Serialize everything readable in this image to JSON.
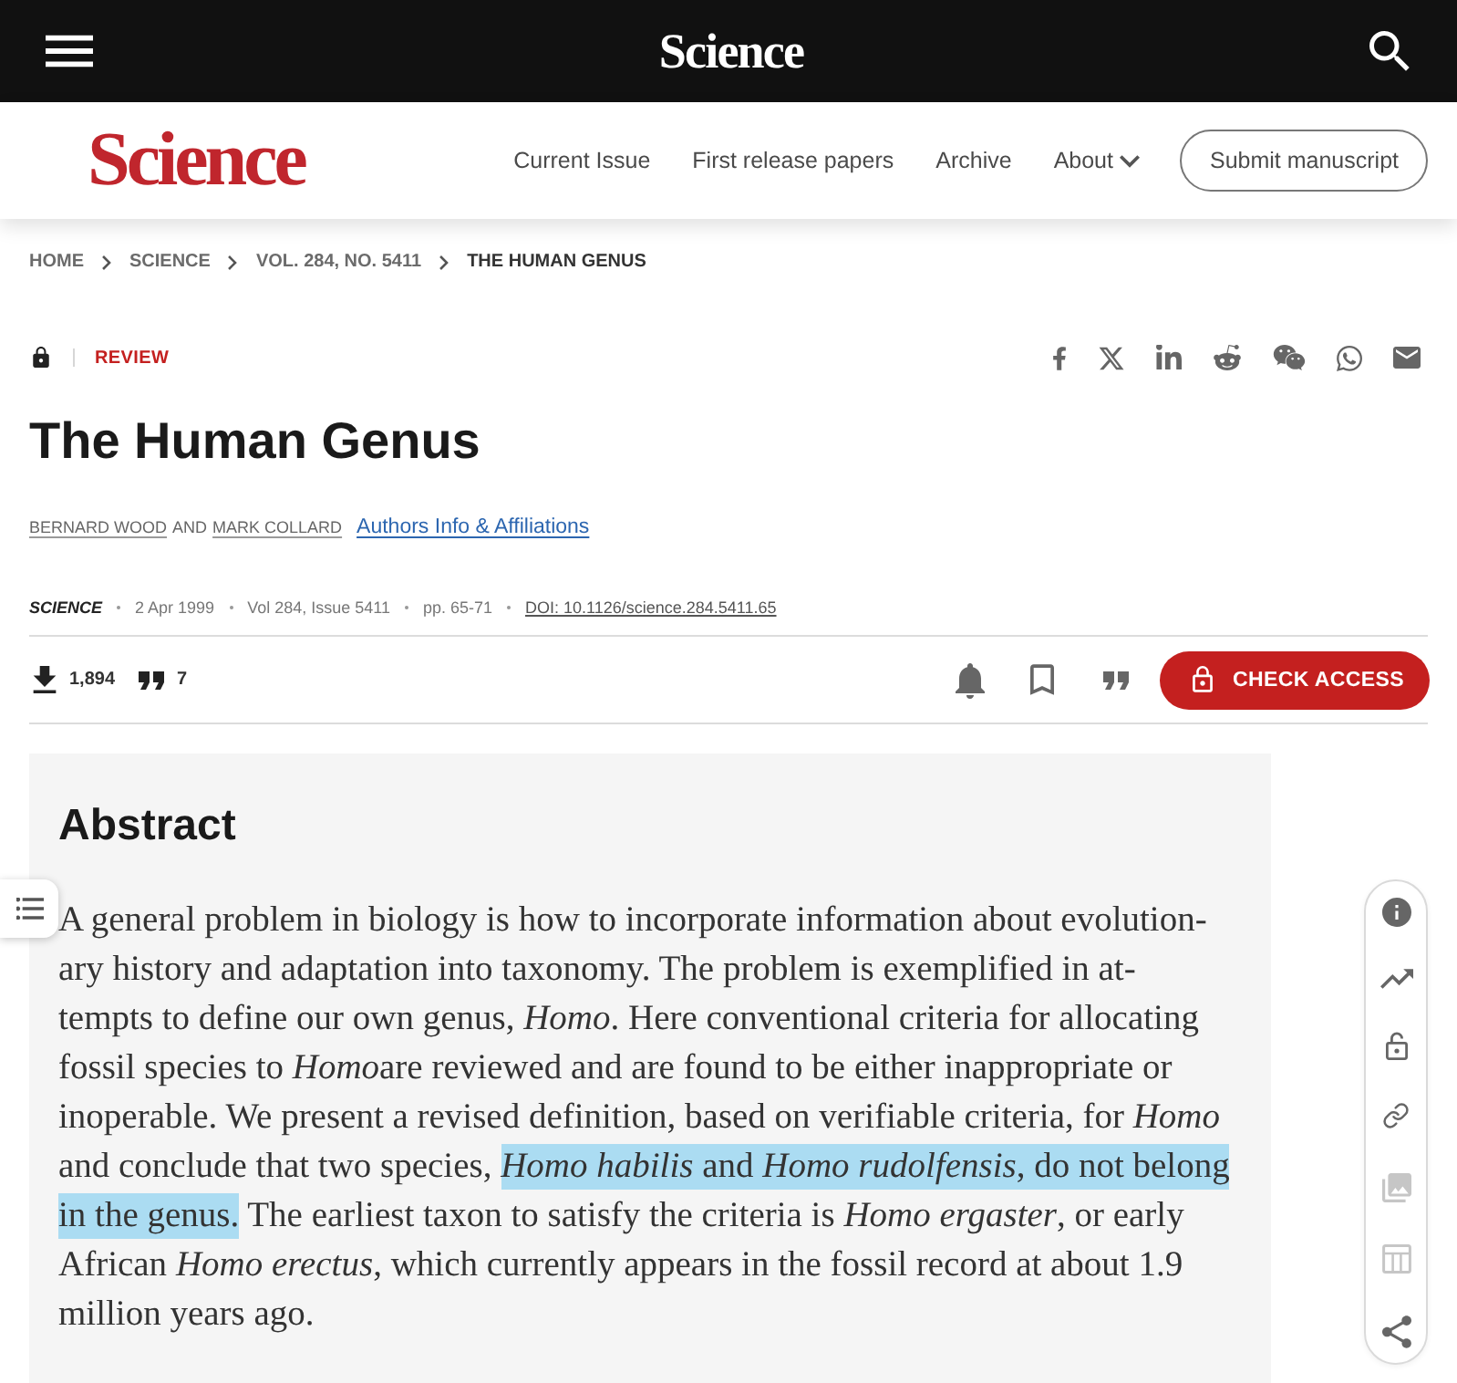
{
  "top_bar": {
    "logo": "Science"
  },
  "header": {
    "logo": "Science",
    "nav": [
      {
        "label": "Current Issue",
        "kind": "link"
      },
      {
        "label": "First release papers",
        "kind": "link"
      },
      {
        "label": "Archive",
        "kind": "link"
      },
      {
        "label": "About",
        "kind": "menu"
      }
    ],
    "submit_button": "Submit manuscript"
  },
  "breadcrumb": [
    {
      "label": "HOME",
      "current": false
    },
    {
      "label": "SCIENCE",
      "current": false
    },
    {
      "label": "VOL. 284, NO. 5411",
      "current": false
    },
    {
      "label": "THE HUMAN GENUS",
      "current": true
    }
  ],
  "article": {
    "type_label": "REVIEW",
    "title": "The Human Genus",
    "authors": [
      "BERNARD WOOD",
      "MARK COLLARD"
    ],
    "authors_conjunction": "AND",
    "authors_info_link": "Authors Info & Affiliations",
    "meta": {
      "journal": "SCIENCE",
      "date": "2 Apr 1999",
      "issue": "Vol 284, Issue 5411",
      "pages": "pp. 65-71",
      "doi": "DOI: 10.1126/science.284.5411.65"
    },
    "downloads": "1,894",
    "citations": "7",
    "check_access_button": "CHECK ACCESS"
  },
  "abstract": {
    "heading": "Abstract",
    "runs": [
      {
        "text": "A general problem in biology is how to incorporate information about evolution-\nary history and adaptation into taxonomy. The problem is exemplified in at-\ntempts to define our own genus, *Homo*. Here conventional criteria for allocating\nfossil species to ",
        "highlighted": false
      },
      {
        "text": "*Homo*",
        "highlighted": false
      },
      {
        "text": "are reviewed and are found to be either inappropriate or\ninoperable. We present a revised definition, based on verifiable criteria, for *Homo*\nand conclude that two species, ",
        "highlighted": false
      },
      {
        "text": "*Homo habilis* and *Homo rudolfensis*, do not belong\nin the genus.",
        "highlighted": true
      },
      {
        "text": " The earliest taxon to satisfy the criteria is *Homo ergaster*, or early\nAfrican *Homo erectus*, which currently appears in the fossil record at about 1.9\nmillion years ago.",
        "highlighted": false
      }
    ]
  },
  "side_tools": [
    {
      "disabled": false
    },
    {
      "disabled": false
    },
    {
      "disabled": false
    },
    {
      "disabled": false
    },
    {
      "disabled": true
    },
    {
      "disabled": true
    },
    {
      "disabled": false
    }
  ]
}
